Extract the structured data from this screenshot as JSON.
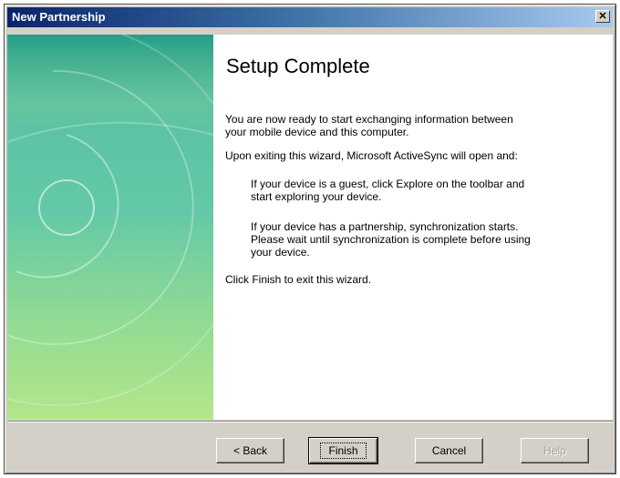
{
  "window": {
    "title": "New Partnership",
    "close_glyph": "✕"
  },
  "page": {
    "heading": "Setup Complete",
    "p1_line1": "You are now ready to start exchanging information between",
    "p1_line2": "your mobile device and this computer.",
    "p2": "Upon exiting this wizard, Microsoft ActiveSync will open and:",
    "p3_line1": "If your device is a guest, click Explore on the toolbar and",
    "p3_line2": "start exploring your device.",
    "p4_line1": "If your device has a partnership, synchronization starts.",
    "p4_line2": "Please wait until synchronization is complete before using",
    "p4_line3": "your device.",
    "p5": "Click Finish to exit this wizard."
  },
  "buttons": {
    "back_label": "< Back",
    "finish_label": "Finish",
    "cancel_label": "Cancel",
    "help_label": "Help"
  },
  "colors": {
    "titlebar_start": "#0a246a",
    "titlebar_end": "#a6caf0",
    "dialog_face": "#d4d0c8",
    "banner_top": "#2aa48d",
    "banner_bottom": "#b4e68a"
  }
}
